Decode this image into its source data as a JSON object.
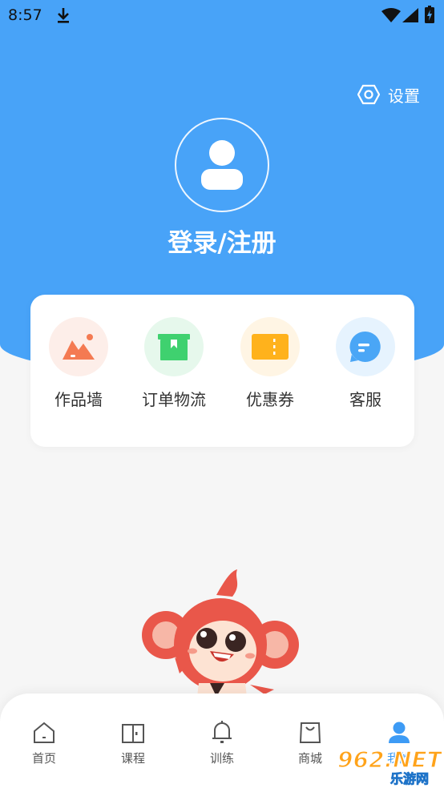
{
  "status_bar": {
    "time": "8:57"
  },
  "header": {
    "settings_label": "设置",
    "login_label": "登录/注册"
  },
  "quick_actions": [
    {
      "label": "作品墙",
      "icon": "gallery-icon",
      "bg": "#fdeee9",
      "color": "#f47a52"
    },
    {
      "label": "订单物流",
      "icon": "package-icon",
      "bg": "#e6f8ec",
      "color": "#3fd16f"
    },
    {
      "label": "优惠券",
      "icon": "coupon-icon",
      "bg": "#fff5e4",
      "color": "#ffb21c"
    },
    {
      "label": "客服",
      "icon": "chat-icon",
      "bg": "#e6f3fe",
      "color": "#4aa6f6"
    }
  ],
  "tabs": [
    {
      "label": "首页",
      "icon": "home-icon",
      "active": false
    },
    {
      "label": "课程",
      "icon": "book-icon",
      "active": false
    },
    {
      "label": "训练",
      "icon": "bell-icon",
      "active": false
    },
    {
      "label": "商城",
      "icon": "bag-icon",
      "active": false
    },
    {
      "label": "我的",
      "icon": "user-icon",
      "active": true
    }
  ],
  "watermark": {
    "logo_text": "962.NET",
    "sub_text": "乐游网"
  },
  "colors": {
    "primary": "#48a3f8",
    "tab_active": "#3d9bf5",
    "mascot": "#e9574a"
  }
}
